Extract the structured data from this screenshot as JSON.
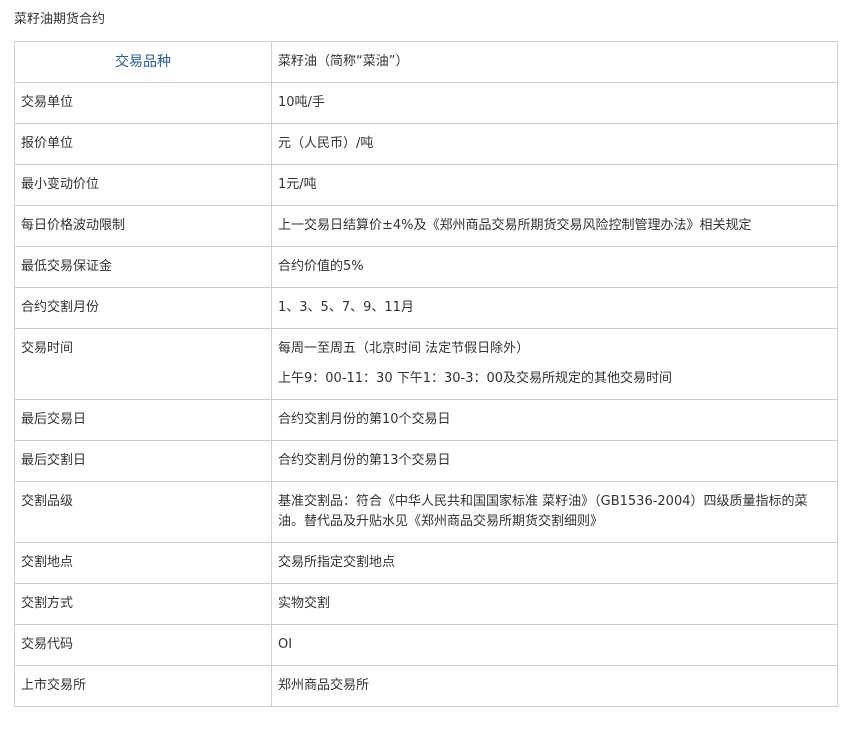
{
  "page": {
    "title": "菜籽油期货合约"
  },
  "table": {
    "header": {
      "label": "交易品种",
      "value": "菜籽油（简称“菜油”）"
    },
    "rows": [
      {
        "label": "交易单位",
        "value": "10吨/手"
      },
      {
        "label": "报价单位",
        "value": "元（人民币）/吨"
      },
      {
        "label": "最小变动价位",
        "value": "1元/吨"
      },
      {
        "label": "每日价格波动限制",
        "value": "上一交易日结算价±4%及《郑州商品交易所期货交易风险控制管理办法》相关规定"
      },
      {
        "label": "最低交易保证金",
        "value": "合约价值的5%"
      },
      {
        "label": "合约交割月份",
        "value": "1、3、5、7、9、11月"
      },
      {
        "label": "交易时间",
        "lines": [
          "每周一至周五（北京时间 法定节假日除外）",
          "上午9：00-11：30 下午1：30-3：00及交易所规定的其他交易时间"
        ]
      },
      {
        "label": "最后交易日",
        "value": "合约交割月份的第10个交易日"
      },
      {
        "label": "最后交割日",
        "value": "合约交割月份的第13个交易日"
      },
      {
        "label": "交割品级",
        "value": "基准交割品：符合《中华人民共和国国家标准 菜籽油》（GB1536-2004）四级质量指标的菜油。替代品及升贴水见《郑州商品交易所期货交割细则》"
      },
      {
        "label": "交割地点",
        "value": "交易所指定交割地点"
      },
      {
        "label": "交割方式",
        "value": "实物交割"
      },
      {
        "label": "交易代码",
        "value": "OI"
      },
      {
        "label": "上市交易所",
        "value": "郑州商品交易所"
      }
    ]
  }
}
